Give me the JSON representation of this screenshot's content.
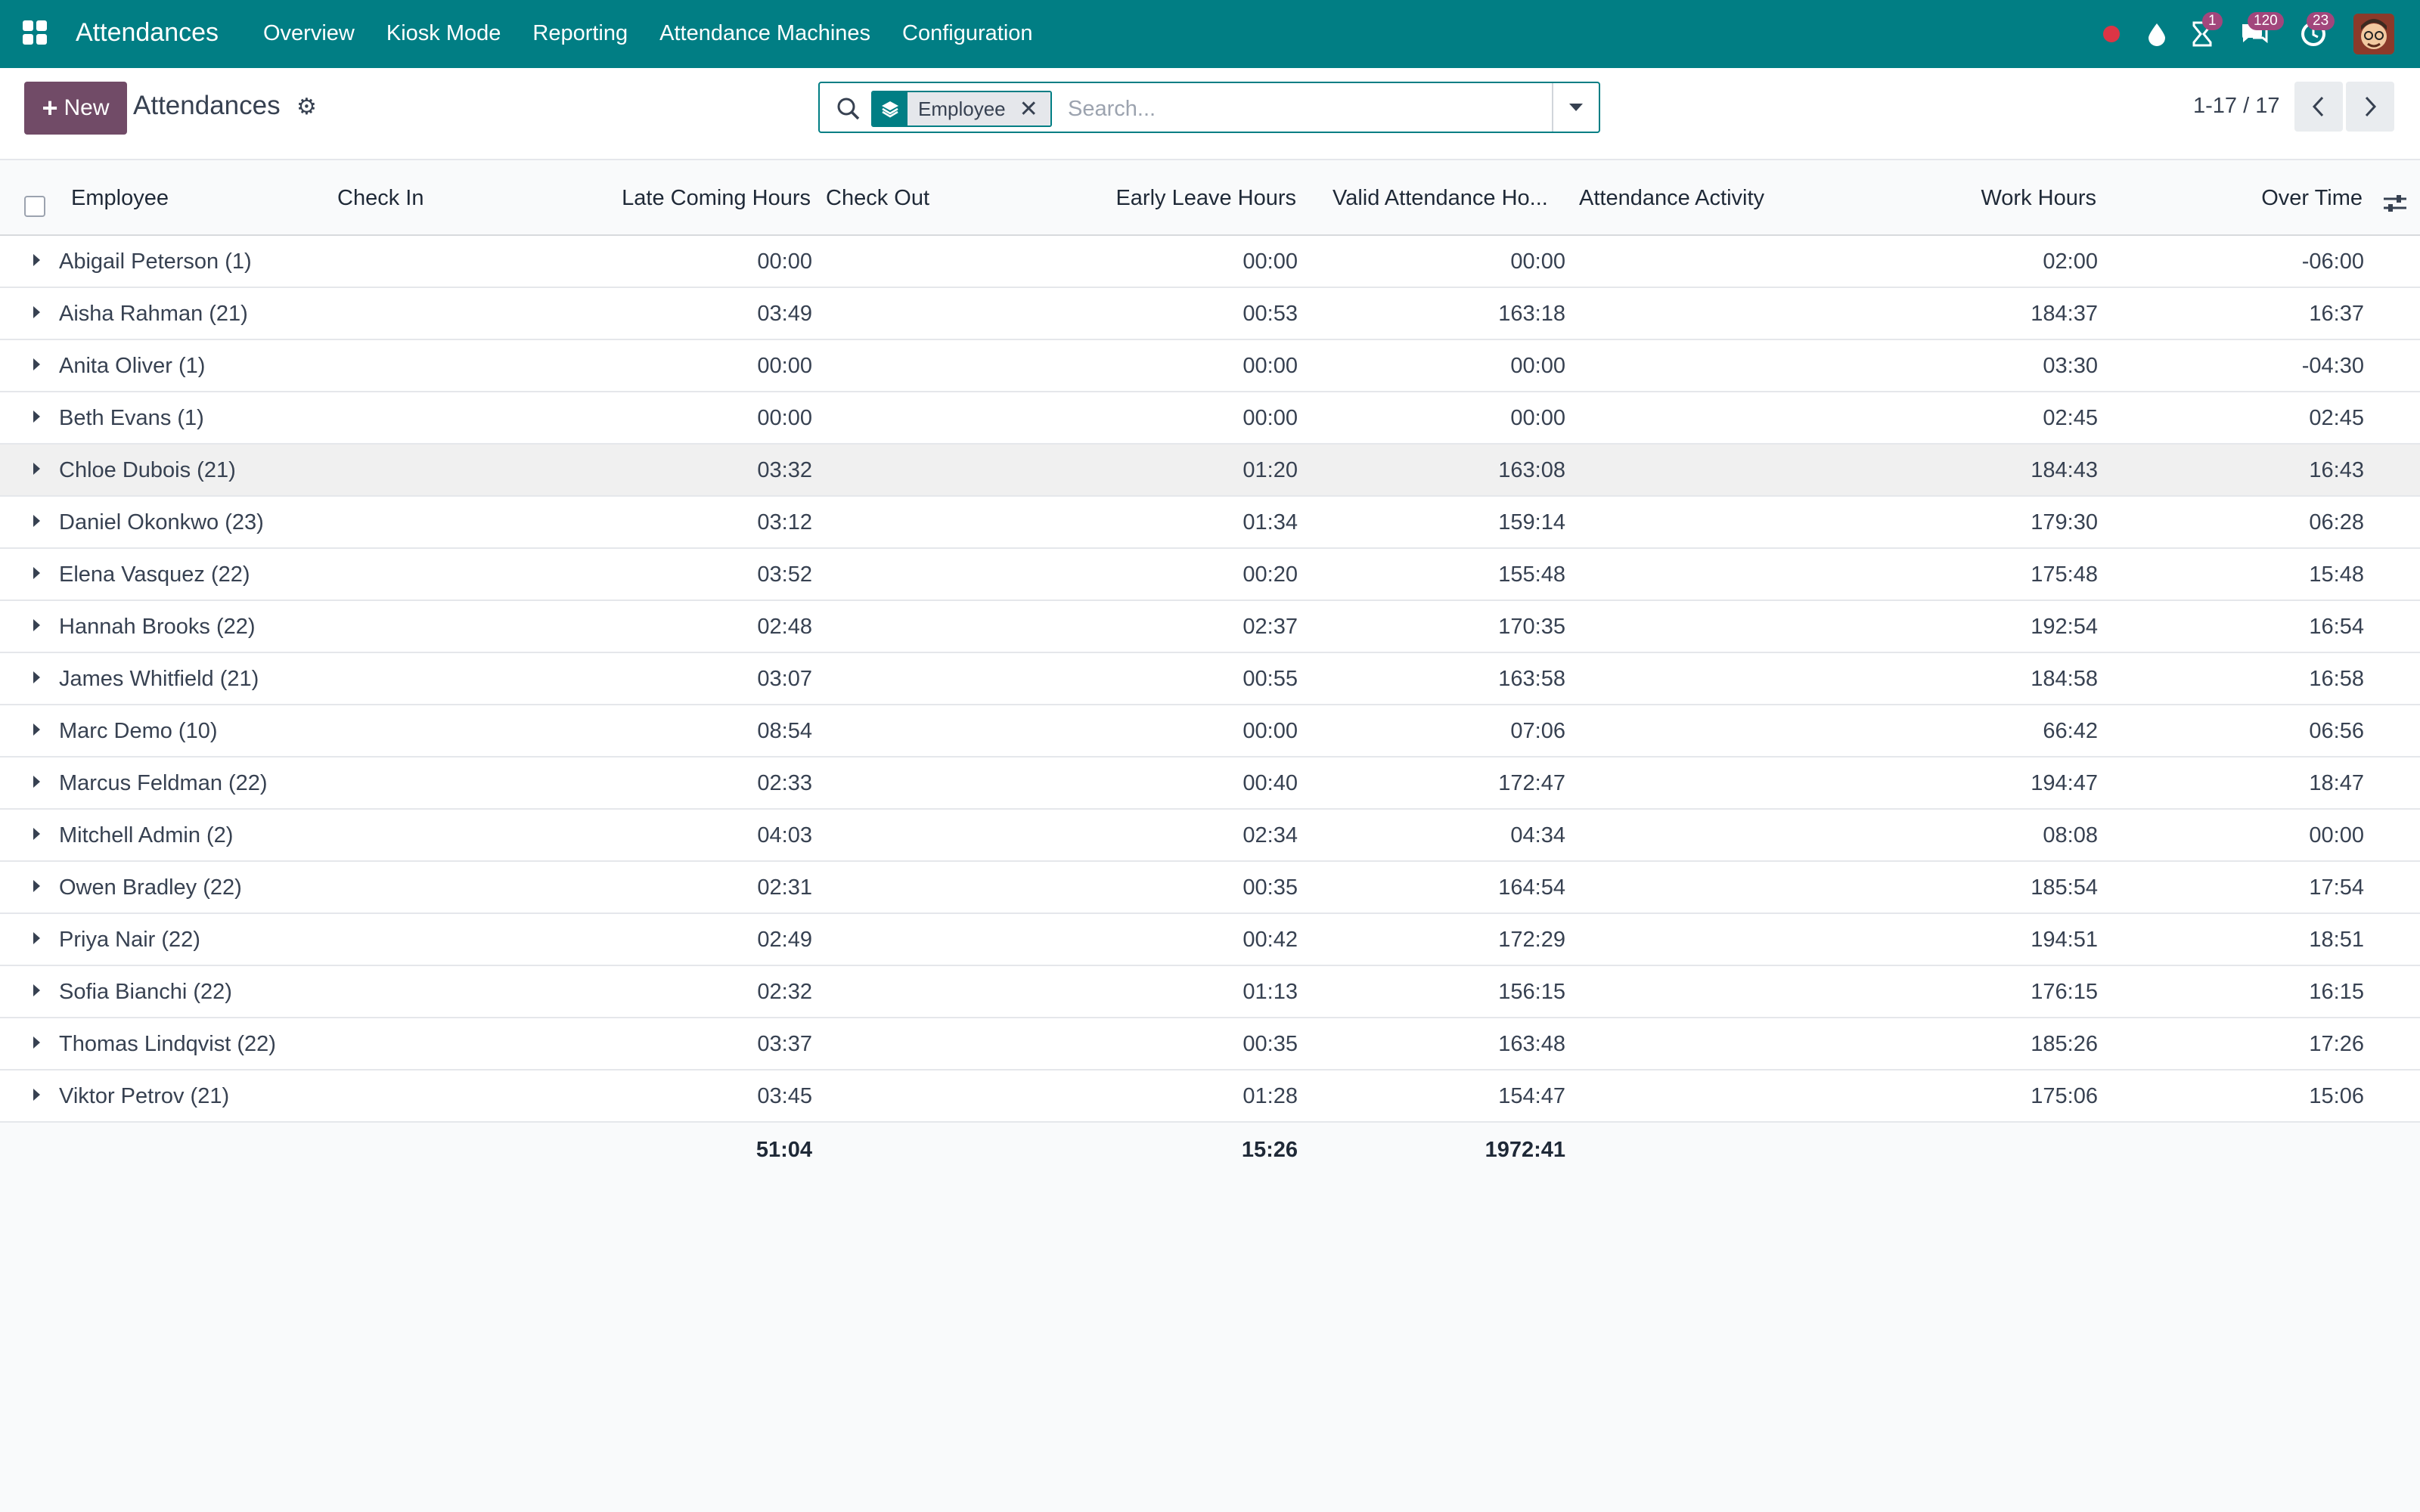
{
  "navbar": {
    "brand": "Attendances",
    "menu": [
      "Overview",
      "Kiosk Mode",
      "Reporting",
      "Attendance Machines",
      "Configuration"
    ],
    "badges": {
      "activities": "1",
      "messages": "120",
      "timers": "23"
    },
    "accent_color": "#017e84"
  },
  "control": {
    "new_label": "New",
    "title": "Attendances",
    "search": {
      "facet": "Employee",
      "placeholder": "Search..."
    },
    "pager": "1-17 / 17"
  },
  "table": {
    "headers": {
      "employee": "Employee",
      "check_in": "Check In",
      "late": "Late Coming Hours",
      "check_out": "Check Out",
      "early": "Early Leave Hours",
      "valid": "Valid Attendance Ho...",
      "activity": "Attendance Activity",
      "work": "Work Hours",
      "over": "Over Time"
    },
    "rows": [
      {
        "name": "Abigail Peterson (1)",
        "late": "00:00",
        "early": "00:00",
        "valid": "00:00",
        "work": "02:00",
        "over": "-06:00"
      },
      {
        "name": "Aisha Rahman (21)",
        "late": "03:49",
        "early": "00:53",
        "valid": "163:18",
        "work": "184:37",
        "over": "16:37"
      },
      {
        "name": "Anita Oliver (1)",
        "late": "00:00",
        "early": "00:00",
        "valid": "00:00",
        "work": "03:30",
        "over": "-04:30"
      },
      {
        "name": "Beth Evans (1)",
        "late": "00:00",
        "early": "00:00",
        "valid": "00:00",
        "work": "02:45",
        "over": "02:45"
      },
      {
        "name": "Chloe Dubois (21)",
        "late": "03:32",
        "early": "01:20",
        "valid": "163:08",
        "work": "184:43",
        "over": "16:43"
      },
      {
        "name": "Daniel Okonkwo (23)",
        "late": "03:12",
        "early": "01:34",
        "valid": "159:14",
        "work": "179:30",
        "over": "06:28"
      },
      {
        "name": "Elena Vasquez (22)",
        "late": "03:52",
        "early": "00:20",
        "valid": "155:48",
        "work": "175:48",
        "over": "15:48"
      },
      {
        "name": "Hannah Brooks (22)",
        "late": "02:48",
        "early": "02:37",
        "valid": "170:35",
        "work": "192:54",
        "over": "16:54"
      },
      {
        "name": "James Whitfield (21)",
        "late": "03:07",
        "early": "00:55",
        "valid": "163:58",
        "work": "184:58",
        "over": "16:58"
      },
      {
        "name": "Marc Demo (10)",
        "late": "08:54",
        "early": "00:00",
        "valid": "07:06",
        "work": "66:42",
        "over": "06:56"
      },
      {
        "name": "Marcus Feldman (22)",
        "late": "02:33",
        "early": "00:40",
        "valid": "172:47",
        "work": "194:47",
        "over": "18:47"
      },
      {
        "name": "Mitchell Admin (2)",
        "late": "04:03",
        "early": "02:34",
        "valid": "04:34",
        "work": "08:08",
        "over": "00:00"
      },
      {
        "name": "Owen Bradley (22)",
        "late": "02:31",
        "early": "00:35",
        "valid": "164:54",
        "work": "185:54",
        "over": "17:54"
      },
      {
        "name": "Priya Nair (22)",
        "late": "02:49",
        "early": "00:42",
        "valid": "172:29",
        "work": "194:51",
        "over": "18:51"
      },
      {
        "name": "Sofia Bianchi (22)",
        "late": "02:32",
        "early": "01:13",
        "valid": "156:15",
        "work": "176:15",
        "over": "16:15"
      },
      {
        "name": "Thomas Lindqvist (22)",
        "late": "03:37",
        "early": "00:35",
        "valid": "163:48",
        "work": "185:26",
        "over": "17:26"
      },
      {
        "name": "Viktor Petrov (21)",
        "late": "03:45",
        "early": "01:28",
        "valid": "154:47",
        "work": "175:06",
        "over": "15:06"
      }
    ],
    "totals": {
      "late": "51:04",
      "early": "15:26",
      "valid": "1972:41"
    }
  }
}
